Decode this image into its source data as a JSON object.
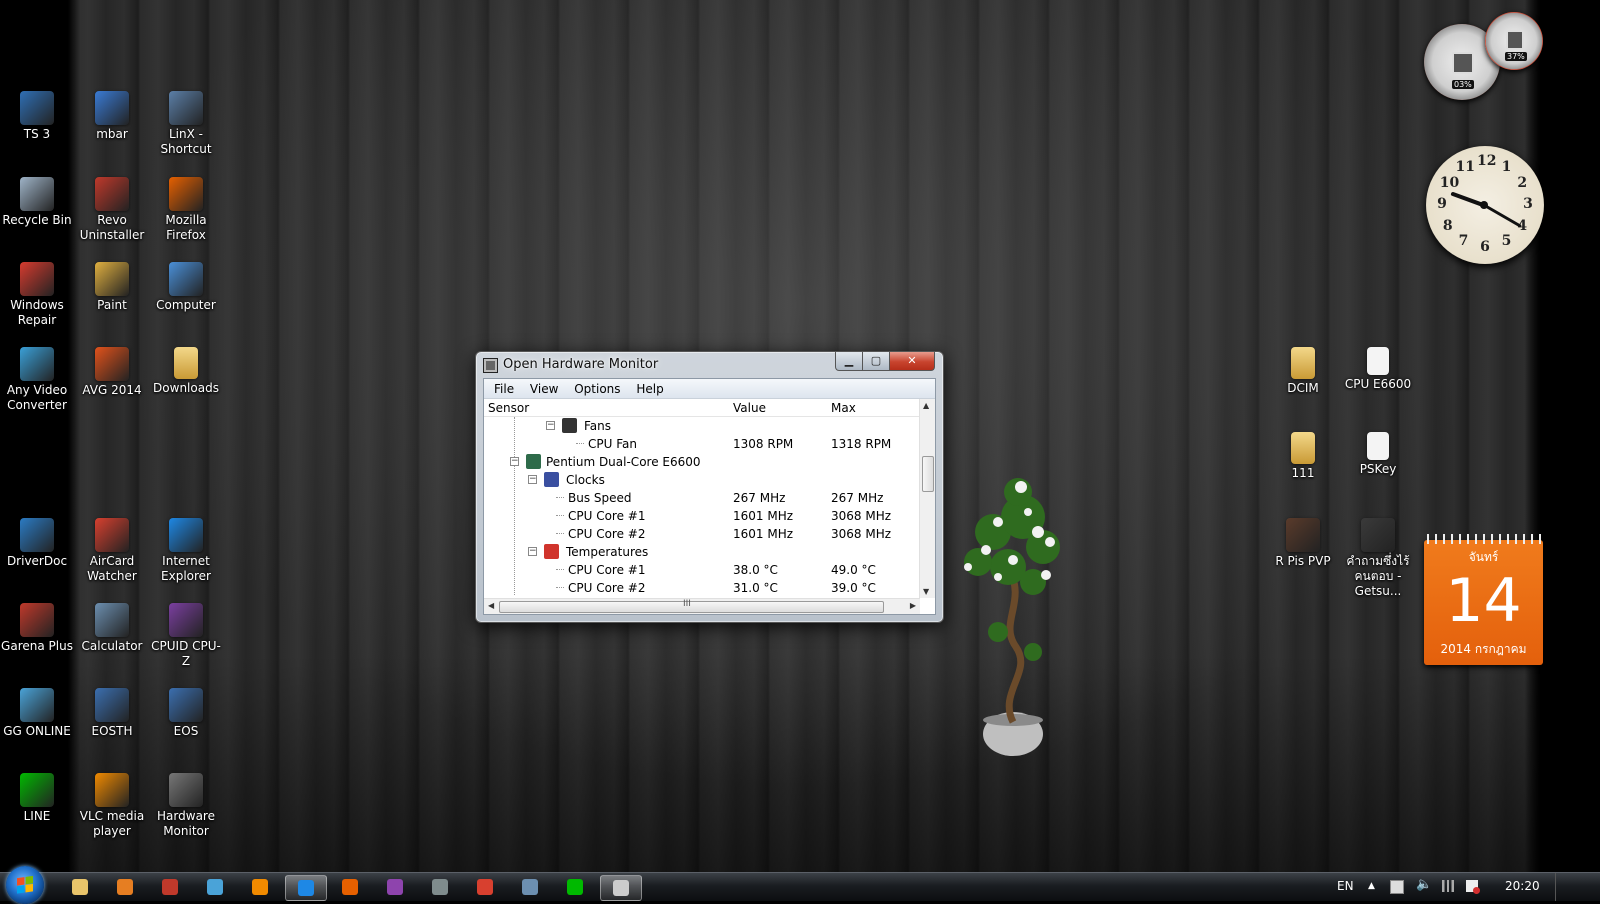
{
  "desktop_icons": [
    {
      "label": "TS 3",
      "icon": "ts3-icon",
      "color": "#2f6fb5"
    },
    {
      "label": "mbar",
      "icon": "mbar-icon",
      "color": "#3a7bd5"
    },
    {
      "label": "LinX - Shortcut",
      "icon": "linx-icon",
      "color": "#5b7fa8"
    },
    {
      "label": "Recycle Bin",
      "icon": "recycle-bin-icon",
      "color": "#9fb4c8"
    },
    {
      "label": "Revo Uninstaller",
      "icon": "revo-uninstaller-icon",
      "color": "#c0392b"
    },
    {
      "label": "Mozilla Firefox",
      "icon": "firefox-icon",
      "color": "#e66000"
    },
    {
      "label": "Windows Repair",
      "icon": "windows-repair-icon",
      "color": "#d63b2f"
    },
    {
      "label": "Paint",
      "icon": "paint-icon",
      "color": "#e0b040"
    },
    {
      "label": "Computer",
      "icon": "computer-icon",
      "color": "#4a90d9"
    },
    {
      "label": "Any Video Converter",
      "icon": "video-converter-icon",
      "color": "#3aa0d8"
    },
    {
      "label": "AVG 2014",
      "icon": "avg-icon",
      "color": "#e2521b"
    },
    {
      "label": "Downloads",
      "icon": "downloads-folder-icon",
      "color": "#e8c46a"
    },
    {
      "label": "DriverDoc",
      "icon": "driverdoc-icon",
      "color": "#2b7bc4"
    },
    {
      "label": "AirCard Watcher",
      "icon": "aircard-watcher-icon",
      "color": "#d8402f"
    },
    {
      "label": "Internet Explorer",
      "icon": "internet-explorer-icon",
      "color": "#1e88e5"
    },
    {
      "label": "Garena Plus",
      "icon": "garena-icon",
      "color": "#c0392b"
    },
    {
      "label": "Calculator",
      "icon": "calculator-icon",
      "color": "#6c8fb0"
    },
    {
      "label": "CPUID CPU-Z",
      "icon": "cpuz-icon",
      "color": "#7b3fa0"
    },
    {
      "label": "GG ONLINE",
      "icon": "gg-online-icon",
      "color": "#4aa3d8"
    },
    {
      "label": "EOSTH",
      "icon": "eosth-icon",
      "color": "#3b6fb0"
    },
    {
      "label": "EOS",
      "icon": "eos-icon",
      "color": "#3b6fb0"
    },
    {
      "label": "LINE",
      "icon": "line-icon",
      "color": "#00b900"
    },
    {
      "label": "VLC media player",
      "icon": "vlc-icon",
      "color": "#f08a00"
    },
    {
      "label": "Hardware Monitor",
      "icon": "hardware-monitor-icon",
      "color": "#777777"
    },
    {
      "label": "DCIM",
      "icon": "folder-icon",
      "color": "#e8c46a"
    },
    {
      "label": "CPU E6600",
      "icon": "document-icon",
      "color": "#f2f2f2"
    },
    {
      "label": "111",
      "icon": "folder-icon",
      "color": "#e8c46a"
    },
    {
      "label": "PSKey",
      "icon": "document-icon",
      "color": "#f2f2f2"
    },
    {
      "label": "R Pis PVP",
      "icon": "image-thumb-icon",
      "color": "#5a3b2b"
    },
    {
      "label": "คำถามซึ่งไร้คนตอบ - Getsu...",
      "icon": "image-thumb-icon",
      "color": "#3a3a3a"
    }
  ],
  "window": {
    "title": "Open Hardware Monitor",
    "menu": [
      "File",
      "View",
      "Options",
      "Help"
    ],
    "columns": [
      "Sensor",
      "Value",
      "Max"
    ],
    "rows": [
      {
        "sensor": "Fans",
        "value": "",
        "max": "",
        "level": 3,
        "type": "group",
        "icon": "fan-icon"
      },
      {
        "sensor": "CPU Fan",
        "value": "1308 RPM",
        "max": "1318 RPM",
        "level": 4,
        "type": "leaf"
      },
      {
        "sensor": "Pentium Dual-Core E6600",
        "value": "",
        "max": "",
        "level": 1,
        "type": "group",
        "icon": "cpu-icon"
      },
      {
        "sensor": "Clocks",
        "value": "",
        "max": "",
        "level": 2,
        "type": "group",
        "icon": "clock-bars-icon"
      },
      {
        "sensor": "Bus Speed",
        "value": "267 MHz",
        "max": "267 MHz",
        "level": 3,
        "type": "leaf"
      },
      {
        "sensor": "CPU Core #1",
        "value": "1601 MHz",
        "max": "3068 MHz",
        "level": 3,
        "type": "leaf"
      },
      {
        "sensor": "CPU Core #2",
        "value": "1601 MHz",
        "max": "3068 MHz",
        "level": 3,
        "type": "leaf"
      },
      {
        "sensor": "Temperatures",
        "value": "",
        "max": "",
        "level": 2,
        "type": "group",
        "icon": "thermometer-icon"
      },
      {
        "sensor": "CPU Core #1",
        "value": "38.0 °C",
        "max": "49.0 °C",
        "level": 3,
        "type": "leaf"
      },
      {
        "sensor": "CPU Core #2",
        "value": "31.0 °C",
        "max": "39.0 °C",
        "level": 3,
        "type": "leaf"
      }
    ],
    "scrollbar_label": "III"
  },
  "gadgets": {
    "cpu_meter": {
      "cpu_percent": "03%",
      "ram_percent": "37%"
    },
    "clock": {
      "numbers": [
        "12",
        "1",
        "2",
        "3",
        "4",
        "5",
        "6",
        "7",
        "8",
        "9",
        "10",
        "11"
      ]
    },
    "calendar": {
      "weekday": "จันทร์",
      "day": "14",
      "month_year": "2014 กรกฎาคม"
    }
  },
  "taskbar": {
    "apps": [
      {
        "name": "explorer-icon",
        "color": "#e8c46a"
      },
      {
        "name": "media-player-icon",
        "color": "#e67e22"
      },
      {
        "name": "garena-icon",
        "color": "#c0392b"
      },
      {
        "name": "gg-online-icon",
        "color": "#4aa3d8"
      },
      {
        "name": "vlc-icon",
        "color": "#f08a00"
      },
      {
        "name": "internet-explorer-icon",
        "color": "#1e88e5",
        "active": true
      },
      {
        "name": "firefox-icon",
        "color": "#e66000"
      },
      {
        "name": "winrar-icon",
        "color": "#8e44ad"
      },
      {
        "name": "game-controller-icon",
        "color": "#7f8c8d"
      },
      {
        "name": "aircard-icon",
        "color": "#d8402f"
      },
      {
        "name": "calculator-icon",
        "color": "#6c8fb0"
      },
      {
        "name": "line-icon",
        "color": "#00b900"
      },
      {
        "name": "hardware-monitor-icon",
        "color": "#cccccc",
        "active": true
      }
    ],
    "language": "EN",
    "time": "20:20"
  },
  "colors": {
    "accent_orange": "#e4600c",
    "window_close": "#c8442e"
  }
}
